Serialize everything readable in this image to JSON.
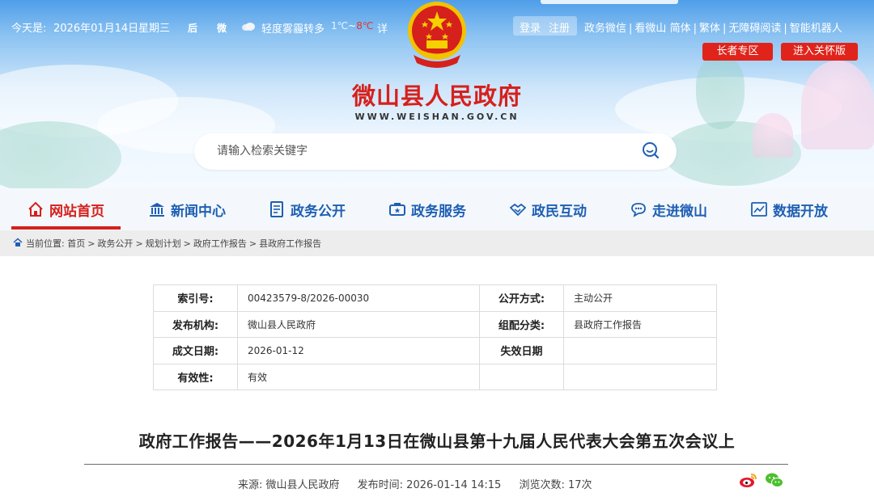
{
  "topbar": {
    "date_label": "今天是:",
    "date": "2026年01月14日",
    "weekday": "星期三",
    "loc1": "后",
    "loc2": "微",
    "weather": "轻度雾霾转多",
    "temp_low": "1℃",
    "temp_sep": "~",
    "temp_high": "8℃",
    "temp_more": "详",
    "login": "登录",
    "register": "注册",
    "links": [
      "政务微信",
      "看微山",
      "简体",
      "繁体",
      "无障碍阅读",
      "智能机器人"
    ],
    "elder_zone": "长者专区",
    "care_edition": "进入关怀版"
  },
  "site": {
    "title": "微山县人民政府",
    "domain": "WWW.WEISHAN.GOV.CN"
  },
  "search": {
    "placeholder": "请输入检索关键字"
  },
  "nav": {
    "items": [
      {
        "label": "网站首页",
        "icon": "home-icon"
      },
      {
        "label": "新闻中心",
        "icon": "building-icon"
      },
      {
        "label": "政务公开",
        "icon": "document-icon"
      },
      {
        "label": "政务服务",
        "icon": "service-icon"
      },
      {
        "label": "政民互动",
        "icon": "handshake-icon"
      },
      {
        "label": "走进微山",
        "icon": "chat-icon"
      },
      {
        "label": "数据开放",
        "icon": "data-icon"
      }
    ]
  },
  "breadcrumb": {
    "prefix": "当前位置:",
    "items": [
      "首页",
      "政务公开",
      "规划计划",
      "政府工作报告",
      "县政府工作报告"
    ]
  },
  "info": {
    "rows": [
      [
        {
          "k": "索引号:",
          "v": "00423579-8/2026-00030"
        },
        {
          "k": "公开方式:",
          "v": "主动公开"
        }
      ],
      [
        {
          "k": "发布机构:",
          "v": "微山县人民政府"
        },
        {
          "k": "组配分类:",
          "v": "县政府工作报告"
        }
      ],
      [
        {
          "k": "成文日期:",
          "v": "2026-01-12"
        },
        {
          "k": "失效日期",
          "v": ""
        }
      ],
      [
        {
          "k": "有效性:",
          "v": "有效"
        },
        {
          "k": "",
          "v": ""
        }
      ]
    ]
  },
  "article": {
    "title": "政府工作报告——2026年1月13日在微山县第十九届人民代表大会第五次会议上",
    "source": "来源: 微山县人民政府",
    "published": "发布时间: 2026-01-14 14:15",
    "views": "浏览次数: 17次"
  },
  "colors": {
    "brand_red": "#d6201c",
    "nav_blue": "#1e5fb3"
  }
}
